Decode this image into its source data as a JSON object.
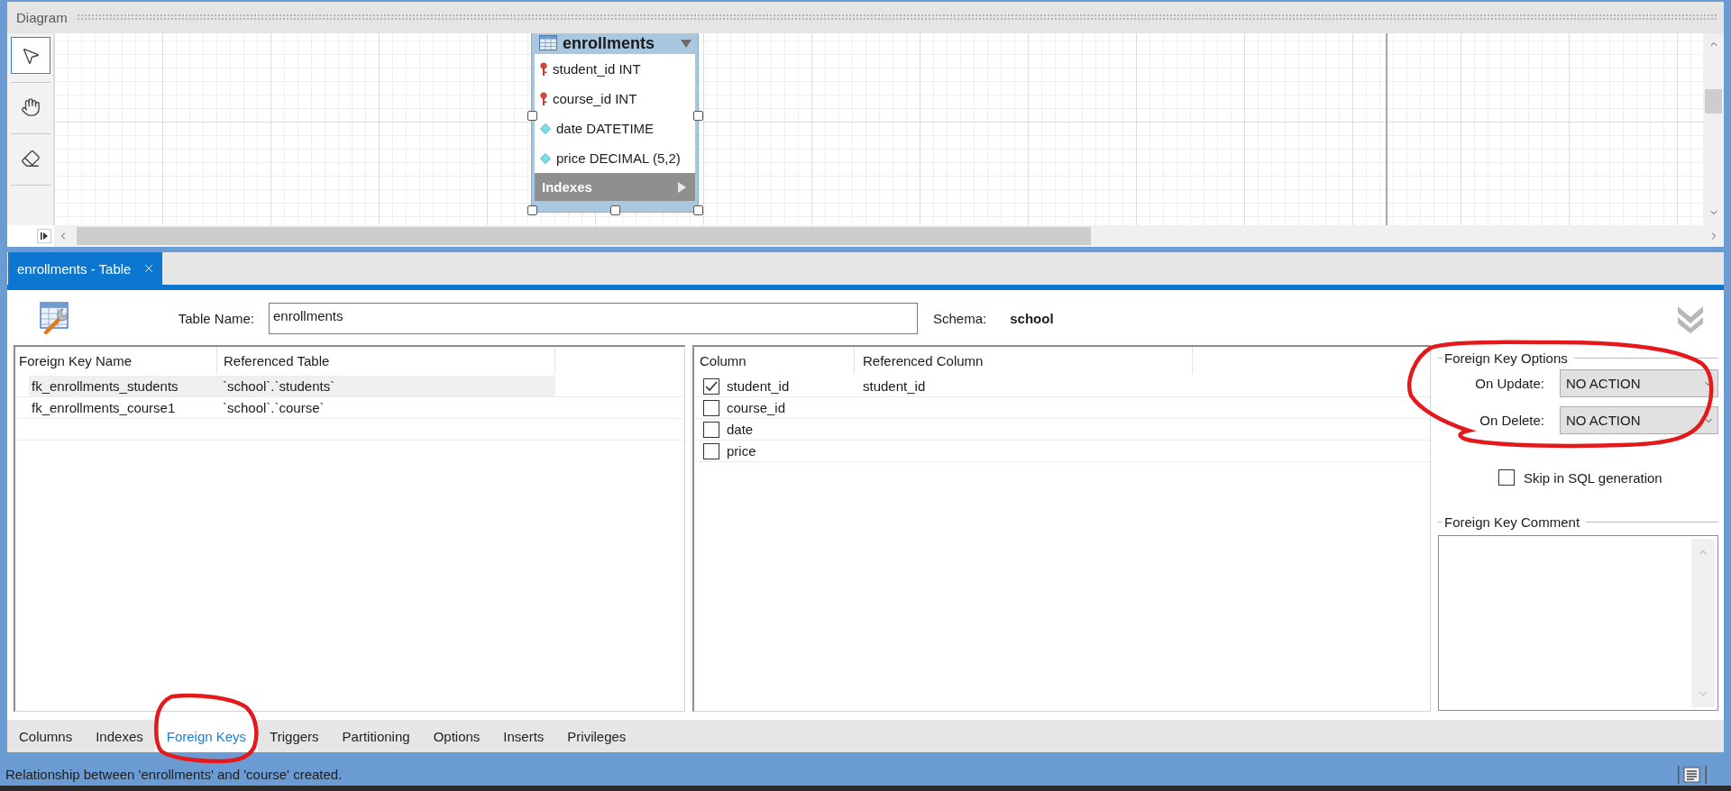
{
  "diagram": {
    "title": "Diagram",
    "tools": [
      {
        "kind": "pointer",
        "selected": true
      },
      {
        "kind": "hand",
        "selected": false
      },
      {
        "kind": "eraser",
        "selected": false
      }
    ],
    "table_node": {
      "name": "enrollments",
      "selected": true,
      "columns": [
        {
          "kind": "primary-key",
          "text": "student_id INT"
        },
        {
          "kind": "primary-key",
          "text": "course_id INT"
        },
        {
          "kind": "column",
          "text": "date DATETIME"
        },
        {
          "kind": "column",
          "text": "price DECIMAL (5,2)"
        }
      ],
      "section": "Indexes"
    }
  },
  "editor_tabs": [
    {
      "label": "enrollments - Table",
      "selected": true
    }
  ],
  "table_name": {
    "label": "Table Name:",
    "value": "enrollments"
  },
  "schema": {
    "label": "Schema:",
    "value": "school"
  },
  "foreign_keys": {
    "columns": [
      "Foreign Key Name",
      "Referenced Table"
    ],
    "rows": [
      {
        "name": "fk_enrollments_students",
        "referenced_table": "`school`.`students`",
        "selected": true
      },
      {
        "name": "fk_enrollments_course1",
        "referenced_table": "`school`.`course`",
        "selected": false
      }
    ]
  },
  "key_columns": {
    "columns": [
      "Column",
      "Referenced Column"
    ],
    "rows": [
      {
        "column": "student_id",
        "checked": true,
        "referenced_column": "student_id"
      },
      {
        "column": "course_id",
        "checked": false
      },
      {
        "column": "date",
        "checked": false
      },
      {
        "column": "price",
        "checked": false
      }
    ]
  },
  "key_options": {
    "title": "Foreign Key Options",
    "circled": true,
    "fields": [
      {
        "label": "On Update:",
        "value": "NO ACTION"
      },
      {
        "label": "On Delete:",
        "value": "NO ACTION"
      }
    ],
    "skip_in_sql": {
      "label": "Skip in SQL generation",
      "checked": false
    },
    "comment_title": "Foreign Key Comment"
  },
  "bottom_tabs": [
    {
      "label": "Columns",
      "selected": false,
      "circled": false
    },
    {
      "label": "Indexes",
      "selected": false,
      "circled": false
    },
    {
      "label": "Foreign Keys",
      "selected": true,
      "circled": true
    },
    {
      "label": "Triggers",
      "selected": false,
      "circled": false
    },
    {
      "label": "Partitioning",
      "selected": false,
      "circled": false
    },
    {
      "label": "Options",
      "selected": false,
      "circled": false
    },
    {
      "label": "Inserts",
      "selected": false,
      "circled": false
    },
    {
      "label": "Privileges",
      "selected": false,
      "circled": false
    }
  ],
  "status_bar": {
    "text": "Relationship between 'enrollments' and 'course' created."
  }
}
